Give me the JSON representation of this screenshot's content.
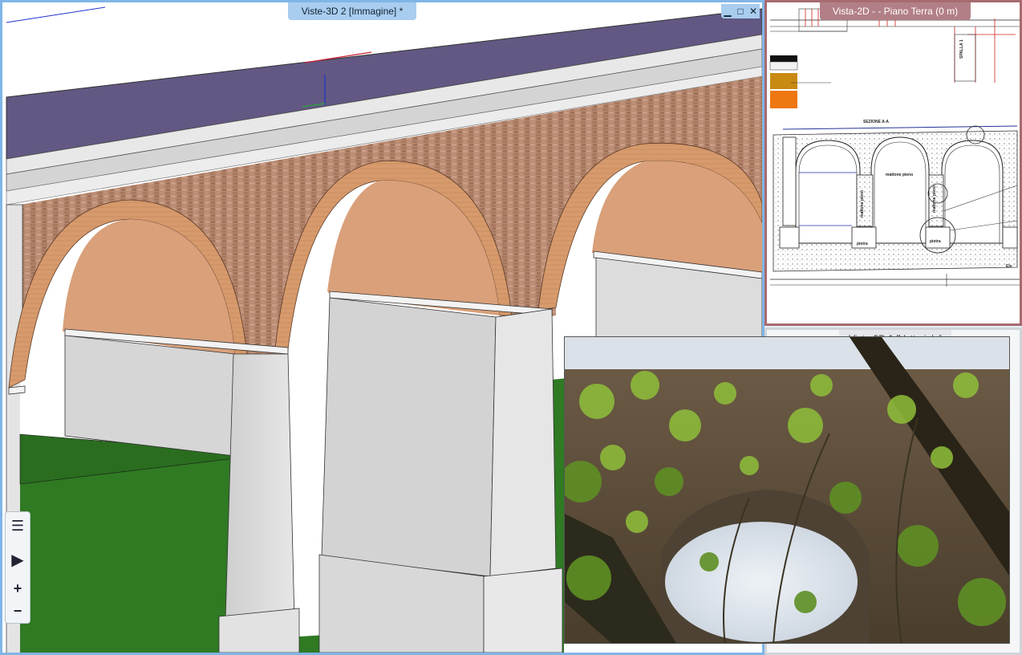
{
  "windows": {
    "view3d2": {
      "title": "Viste-3D 2 [Immagine] *"
    },
    "view2d": {
      "title": "Vista-2D -  - Piano Terra (0 m)"
    },
    "view3d1": {
      "title": "Viste-3D 1 [Vettoriale]"
    }
  },
  "window_controls": {
    "minimize": "▁",
    "restore": "□",
    "close": "✕"
  },
  "toolbox": {
    "list": "☰",
    "play": "▶",
    "zoom_in": "+",
    "zoom_out": "−"
  },
  "drawing_labels": {
    "section": "SEZIONE A-A",
    "brick1": "mattone pieno",
    "brick2": "mattone pieno",
    "brick3": "mattone pieno",
    "stone1": "pietra",
    "stone2": "pietra",
    "spalla": "SPALLA 1",
    "elev": "Elv"
  },
  "colors": {
    "view3d_active_border": "#7fb5e6",
    "view2d_border": "#a86a70",
    "roof": "#625883",
    "arch_intrados": "#d9a07a",
    "brick_wall": "#b78970",
    "pier": "#dedede",
    "grass": "#2f7a22"
  }
}
